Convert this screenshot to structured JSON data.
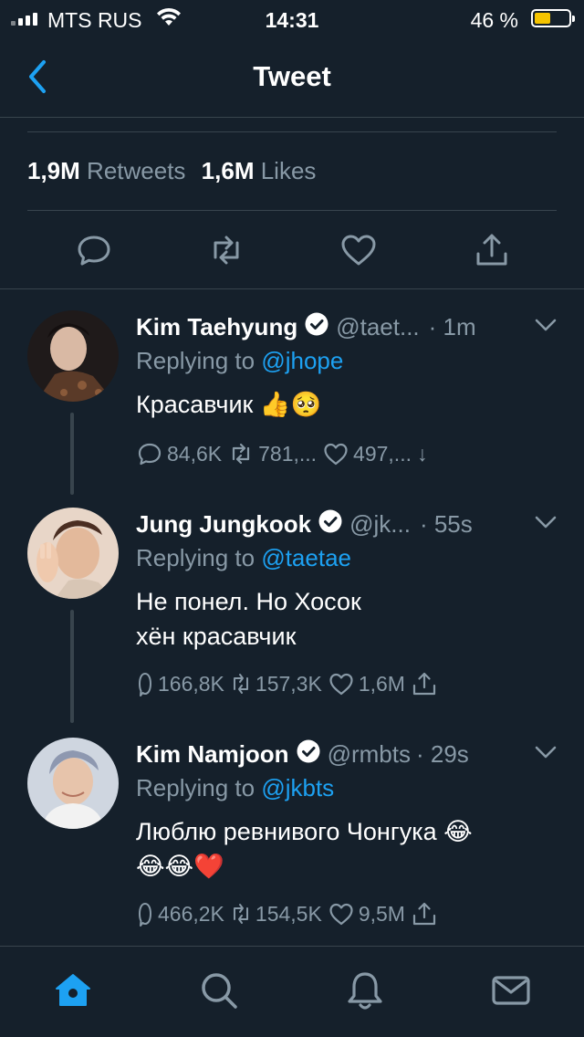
{
  "status_bar": {
    "carrier": "MTS RUS",
    "time": "14:31",
    "battery_text": "46 %",
    "battery_level": 0.46
  },
  "nav": {
    "title": "Tweet"
  },
  "stats": {
    "retweets_count": "1,9M",
    "retweets_label": "Retweets",
    "likes_count": "1,6M",
    "likes_label": "Likes"
  },
  "tweets": [
    {
      "name": "Kim Taehyung",
      "handle": "@taet...",
      "time": "· 1m",
      "replying_prefix": "Replying to",
      "replying_to": "@jhope",
      "text": "Красавчик",
      "emoji": "👍🥺",
      "replies": "84,6K",
      "retweets": "781,...",
      "likes": "497,...",
      "share": "↓"
    },
    {
      "name": "Jung Jungkook",
      "handle": "@jk...",
      "time": "· 55s",
      "replying_prefix": "Replying to",
      "replying_to": "@taetae",
      "text_line1": "Не понел. Но Хосок",
      "text_line2": "хён красавчик",
      "replies": "166,8K",
      "retweets": "157,3K",
      "likes": "1,6M"
    },
    {
      "name": "Kim Namjoon",
      "handle": "@rmbts",
      "time": "· 29s",
      "replying_prefix": "Replying to",
      "replying_to": "@jkbts",
      "text": "Люблю ревнивого Чонгука",
      "emoji_line1": "😂",
      "emoji_line2": "😂😂❤️",
      "replies": "466,2K",
      "retweets": "154,5K",
      "likes": "9,5M"
    }
  ],
  "colors": {
    "background": "#15202b",
    "accent": "#1da1f2",
    "muted": "#8899a6",
    "border": "#38444d",
    "battery": "#f5c400"
  },
  "icons": [
    "back-chevron-icon",
    "reply-icon",
    "retweet-icon",
    "like-icon",
    "share-icon",
    "verified-icon",
    "chevron-down-icon",
    "home-icon",
    "search-icon",
    "notifications-icon",
    "messages-icon"
  ]
}
